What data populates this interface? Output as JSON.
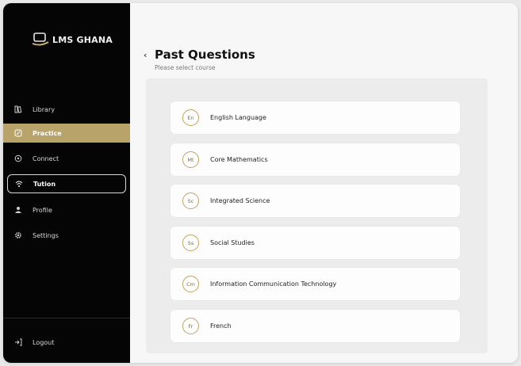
{
  "app": {
    "logo_text": "LMS GHANA"
  },
  "sidebar": {
    "items": [
      {
        "label": "Library",
        "icon": "library-icon"
      },
      {
        "label": "Practice",
        "icon": "practice-icon"
      },
      {
        "label": "Connect",
        "icon": "connect-icon"
      },
      {
        "label": "Tution",
        "icon": "wifi-icon"
      },
      {
        "label": "Profile",
        "icon": "person-icon"
      },
      {
        "label": "Settings",
        "icon": "gear-icon"
      }
    ],
    "logout_label": "Logout",
    "active_color": "#b8a36b"
  },
  "header": {
    "title": "Past Questions",
    "subtitle": "Please select course"
  },
  "courses": [
    {
      "badge": "En",
      "name": "English Language"
    },
    {
      "badge": "Mt",
      "name": "Core Mathematics"
    },
    {
      "badge": "Sc",
      "name": "Integrated Science"
    },
    {
      "badge": "Ss",
      "name": "Social Studies"
    },
    {
      "badge": "Cm",
      "name": "Information Communication Technology"
    },
    {
      "badge": "Fr",
      "name": "French"
    }
  ],
  "colors": {
    "badge_border": "#c4a15d",
    "sidebar_bg": "#050505"
  }
}
